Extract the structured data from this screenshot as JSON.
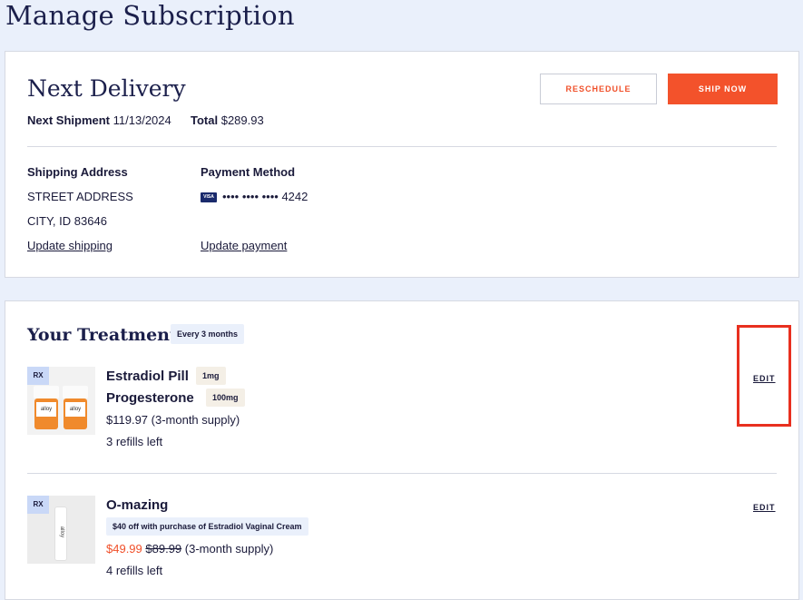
{
  "page": {
    "title": "Manage Subscription"
  },
  "delivery": {
    "title": "Next Delivery",
    "next_shipment_label": "Next Shipment",
    "next_shipment_date": "11/13/2024",
    "total_label": "Total",
    "total_value": "$289.93",
    "reschedule_label": "RESCHEDULE",
    "ship_now_label": "SHIP NOW",
    "shipping": {
      "label": "Shipping Address",
      "line1": "STREET ADDRESS",
      "line2": "CITY, ID 83646",
      "link": "Update shipping"
    },
    "payment": {
      "label": "Payment Method",
      "card_brand": "VISA",
      "card_masked": "•••• •••• •••• 4242",
      "link": "Update payment"
    }
  },
  "treatments": {
    "title": "Your Treatments",
    "frequency": "Every 3 months",
    "items": [
      {
        "rx": "RX",
        "names": [
          {
            "name": "Estradiol Pill",
            "dose": "1mg"
          },
          {
            "name": "Progesterone",
            "dose": "100mg"
          }
        ],
        "brand": "alloy",
        "price": "$119.97 (3-month supply)",
        "refills": "3 refills left",
        "edit_label": "EDIT"
      },
      {
        "rx": "RX",
        "name": "O-mazing",
        "brand": "alloy",
        "promo": "$40 off with purchase of Estradiol Vaginal Cream",
        "sale_price": "$49.99",
        "orig_price": "$89.99",
        "supply": "(3-month supply)",
        "refills": "4 refills left",
        "edit_label": "EDIT"
      }
    ]
  },
  "colors": {
    "accent": "#f3522b",
    "background": "#eaf0fb",
    "highlight": "#e8301f"
  }
}
